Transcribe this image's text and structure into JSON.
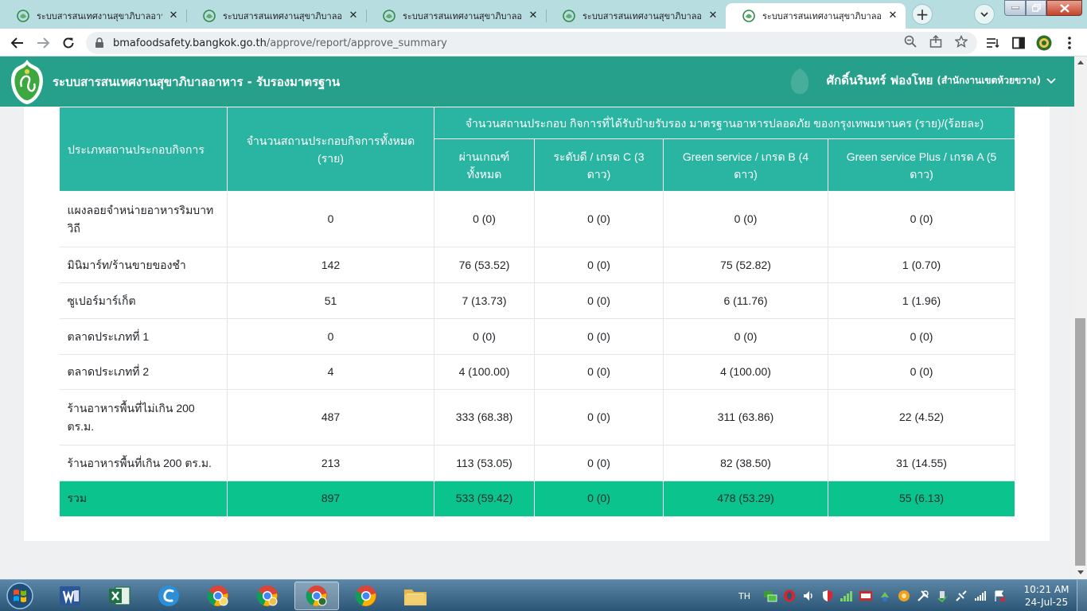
{
  "browser": {
    "tabs": [
      {
        "title": "ระบบสารสนเทศงานสุขาภิบาลอาหาร",
        "active": false
      },
      {
        "title": "ระบบสารสนเทศงานสุขาภิบาลอาหาร",
        "active": false
      },
      {
        "title": "ระบบสารสนเทศงานสุขาภิบาลอาหาร",
        "active": false
      },
      {
        "title": "ระบบสารสนเทศงานสุขาภิบาลอาหาร",
        "active": false
      },
      {
        "title": "ระบบสารสนเทศงานสุขาภิบาลอาหาร",
        "active": true
      }
    ],
    "close_glyph": "✕",
    "new_tab_glyph": "+",
    "url_host": "bmafoodsafety.bangkok.go.th",
    "url_path": "/approve/report/approve_summary"
  },
  "header": {
    "app_title": "ระบบสารสนเทศงานสุขาภิบาลอาหาร - รับรองมาตรฐาน",
    "user_name": "ศักดิ์นรินทร์ ฟองโหย",
    "user_unit": "(สำนักงานเขตห้วยขวาง)"
  },
  "table": {
    "headers": {
      "type": "ประเภทสถานประกอบกิจการ",
      "total": "จำนวนสถานประกอบกิจการทั้งหมด (ราย)",
      "certified_group": "จำนวนสถานประกอบ กิจการที่ได้รับป้ายรับรอง มาตรฐานอาหารปลอดภัย ของกรุงเทพมหานคร (ราย)/(ร้อยละ)",
      "pass_all": "ผ่านเกณฑ์ทั้งหมด",
      "grade_c": "ระดับดี / เกรด C (3 ดาว)",
      "grade_b": "Green service / เกรด B (4 ดาว)",
      "grade_a": "Green service Plus / เกรด A (5 ดาว)"
    },
    "rows": [
      {
        "type": "แผงลอยจำหน่ายอาหารริมบาทวิถี",
        "total": "0",
        "pass_all": "0 (0)",
        "grade_c": "0 (0)",
        "grade_b": "0 (0)",
        "grade_a": "0 (0)"
      },
      {
        "type": "มินิมาร์ท/ร้านขายของชำ",
        "total": "142",
        "pass_all": "76 (53.52)",
        "grade_c": "0 (0)",
        "grade_b": "75 (52.82)",
        "grade_a": "1 (0.70)"
      },
      {
        "type": "ซูเปอร์มาร์เก็ต",
        "total": "51",
        "pass_all": "7 (13.73)",
        "grade_c": "0 (0)",
        "grade_b": "6 (11.76)",
        "grade_a": "1 (1.96)"
      },
      {
        "type": "ตลาดประเภทที่ 1",
        "total": "0",
        "pass_all": "0 (0)",
        "grade_c": "0 (0)",
        "grade_b": "0 (0)",
        "grade_a": "0 (0)"
      },
      {
        "type": "ตลาดประเภทที่ 2",
        "total": "4",
        "pass_all": "4 (100.00)",
        "grade_c": "0 (0)",
        "grade_b": "4 (100.00)",
        "grade_a": "0 (0)"
      },
      {
        "type": "ร้านอาหารพื้นที่ไม่เกิน 200 ตร.ม.",
        "total": "487",
        "pass_all": "333 (68.38)",
        "grade_c": "0 (0)",
        "grade_b": "311 (63.86)",
        "grade_a": "22 (4.52)"
      },
      {
        "type": "ร้านอาหารพื้นที่เกิน 200 ตร.ม.",
        "total": "213",
        "pass_all": "113 (53.05)",
        "grade_c": "0 (0)",
        "grade_b": "82 (38.50)",
        "grade_a": "31 (14.55)"
      }
    ],
    "total_row": {
      "type": "รวม",
      "total": "897",
      "pass_all": "533 (59.42)",
      "grade_c": "0 (0)",
      "grade_b": "478 (53.29)",
      "grade_a": "55 (6.13)"
    }
  },
  "taskbar": {
    "language": "TH",
    "time": "10:21 AM",
    "date": "24-Jul-25"
  },
  "colors": {
    "header_green": "#26a08a",
    "table_header_teal": "#2ab5a3",
    "total_row_green": "#0ac38d",
    "tab_strip": "#b8dde0"
  }
}
